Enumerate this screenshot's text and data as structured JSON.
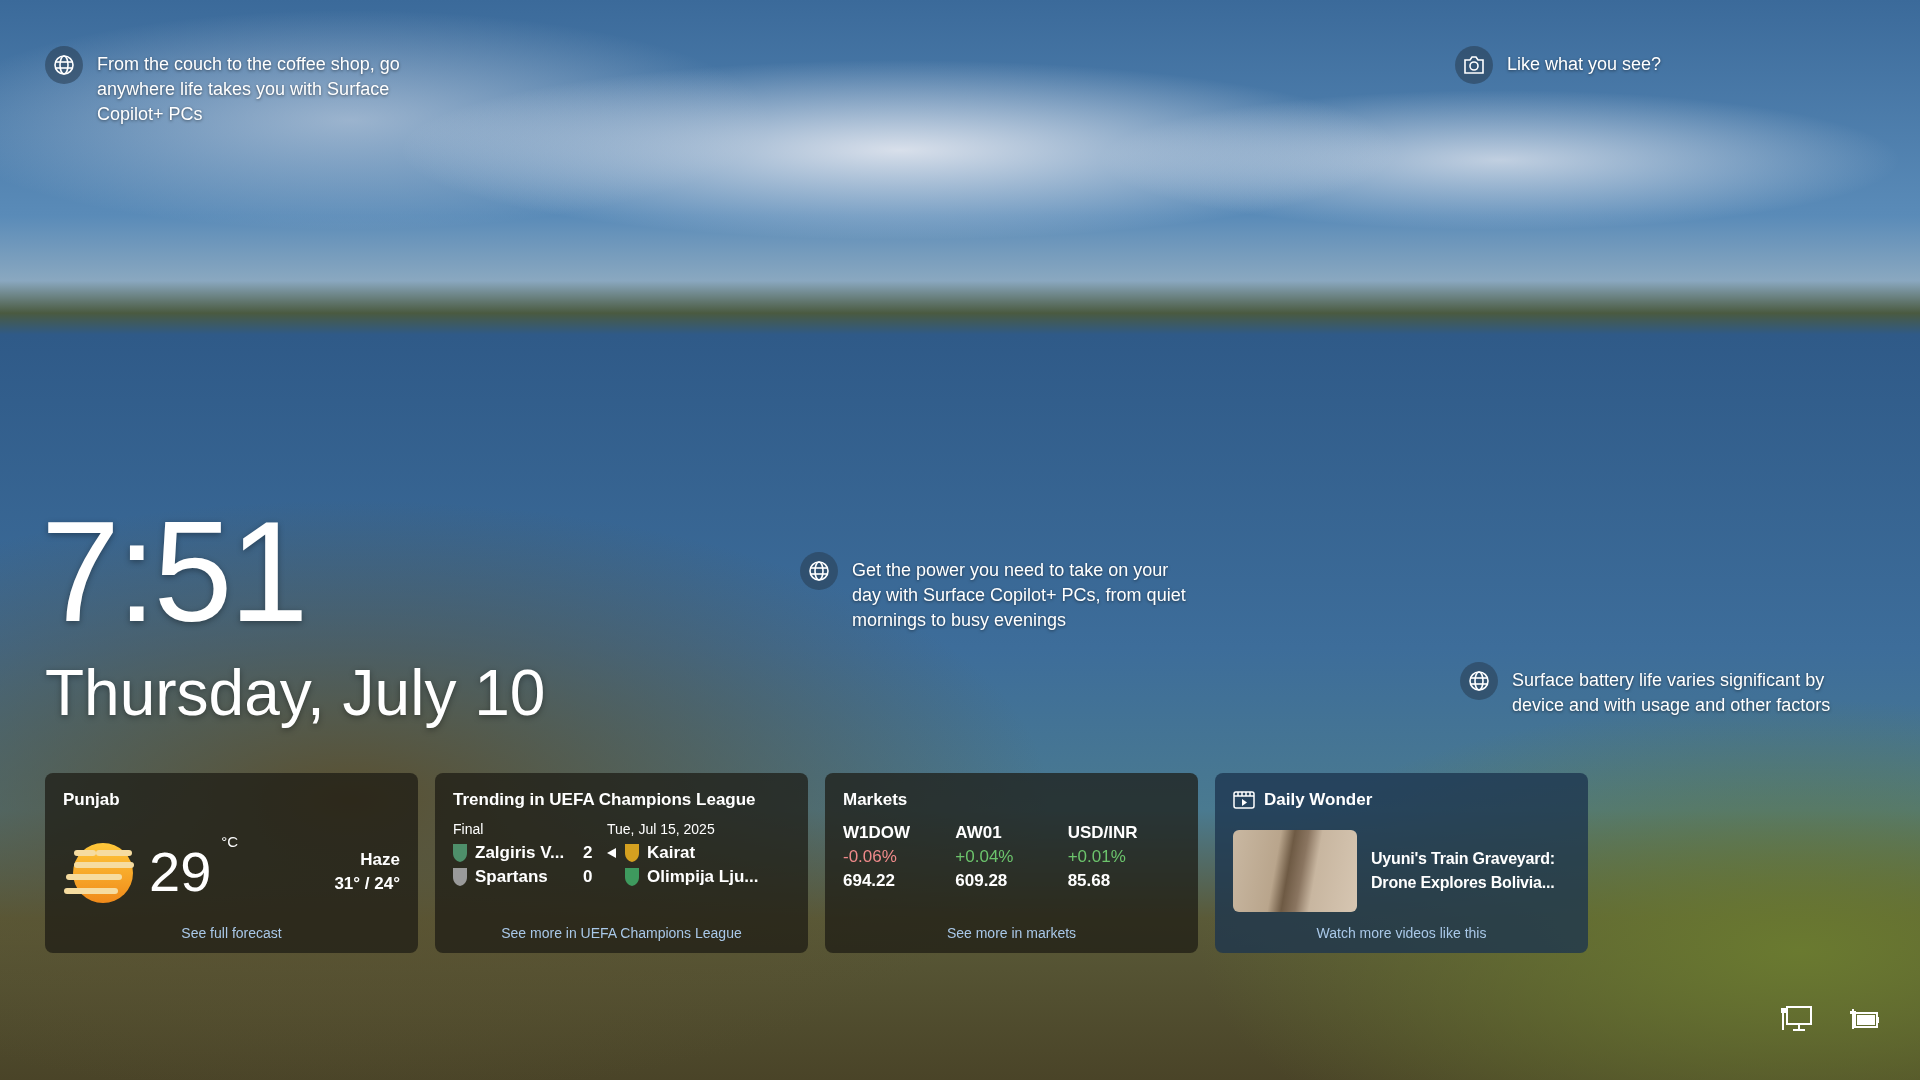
{
  "hotspots": [
    {
      "kind": "globe",
      "text": "From the couch to the coffee shop, go anywhere life takes you with Surface Copilot+ PCs"
    },
    {
      "kind": "camera",
      "text": "Like what you see?"
    },
    {
      "kind": "globe",
      "text": "Get the power you need to take on your day with Surface Copilot+ PCs, from quiet mornings to busy evenings"
    },
    {
      "kind": "globe",
      "text": "Surface battery life varies significant by device and with usage and other factors"
    }
  ],
  "clock": {
    "time": "7:51",
    "date": "Thursday, July 10"
  },
  "cards": [
    {
      "kind": "weather",
      "title": "Punjab",
      "temperature": "29",
      "unit": "°C",
      "condition": "Haze",
      "range": "31° / 24°",
      "link": "See full forecast"
    },
    {
      "kind": "sports",
      "title": "Trending in UEFA Champions League",
      "matches": [
        {
          "status": "Final",
          "teams": [
            {
              "name": "Zalgiris V...",
              "score": "2",
              "winner": true,
              "color": "#4e8f6a"
            },
            {
              "name": "Spartans",
              "score": "0",
              "winner": false,
              "color": "#9a9a9a"
            }
          ]
        },
        {
          "status": "Tue, Jul 15, 2025",
          "teams": [
            {
              "name": "Kairat",
              "winner": false,
              "color": "#d4a020"
            },
            {
              "name": "Olimpija Lju...",
              "winner": false,
              "color": "#3e9a5e"
            }
          ]
        }
      ],
      "link": "See more in UEFA Champions League"
    },
    {
      "kind": "markets",
      "title": "Markets",
      "quotes": [
        {
          "symbol": "W1DOW",
          "change": "-0.06%",
          "up": false,
          "price": "694.22"
        },
        {
          "symbol": "AW01",
          "change": "+0.04%",
          "up": true,
          "price": "609.28"
        },
        {
          "symbol": "USD/INR",
          "change": "+0.01%",
          "up": true,
          "price": "85.68"
        }
      ],
      "link": "See more in markets"
    },
    {
      "kind": "video",
      "title": "Daily Wonder",
      "headline": "Uyuni's Train Graveyard: Drone Explores Bolivia...",
      "link": "Watch more videos like this"
    }
  ]
}
